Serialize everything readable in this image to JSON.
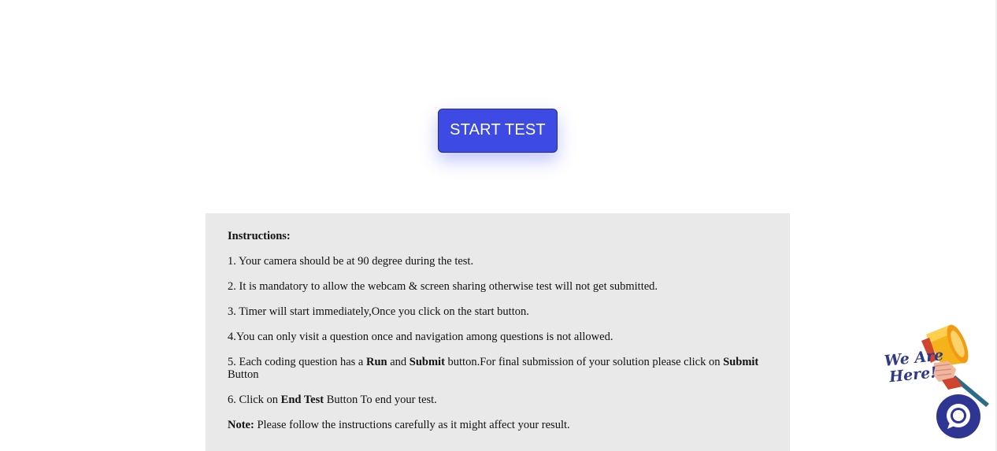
{
  "start_button": {
    "label": "START TEST"
  },
  "instructions": {
    "title": "Instructions:",
    "items": [
      {
        "text": "1. Your camera should be at 90 degree during the test."
      },
      {
        "text": "2. It is mandatory to allow the webcam & screen sharing otherwise test will not get submitted."
      },
      {
        "text": "3. Timer will start immediately,Once you click on the start button."
      },
      {
        "text": "4.You can only visit a question once and navigation among questions is not allowed."
      },
      {
        "pre": "5. Each coding question has a ",
        "bold1": "Run",
        "mid1": " and ",
        "bold2": "Submit",
        "mid2": " button.For final submission of your solution please click on ",
        "bold3": "Submit",
        "post": " Button"
      },
      {
        "pre": "6. Click on ",
        "bold1": "End Test",
        "post": " Button To end your test."
      }
    ],
    "note": {
      "label": "Note:",
      "text": " Please follow the instructions carefully as it might affect your result."
    }
  },
  "support_widget": {
    "badge_line1": "We Are",
    "badge_line2": "Here!",
    "icon": "megaphone-icon",
    "chat_icon": "chat-bubble-icon",
    "colors": {
      "chat_bg": "#2e3592",
      "megaphone": "#f6b21b"
    }
  },
  "colors": {
    "primary_button": "#3d4ae3",
    "instructions_bg": "#e9e9e9"
  }
}
